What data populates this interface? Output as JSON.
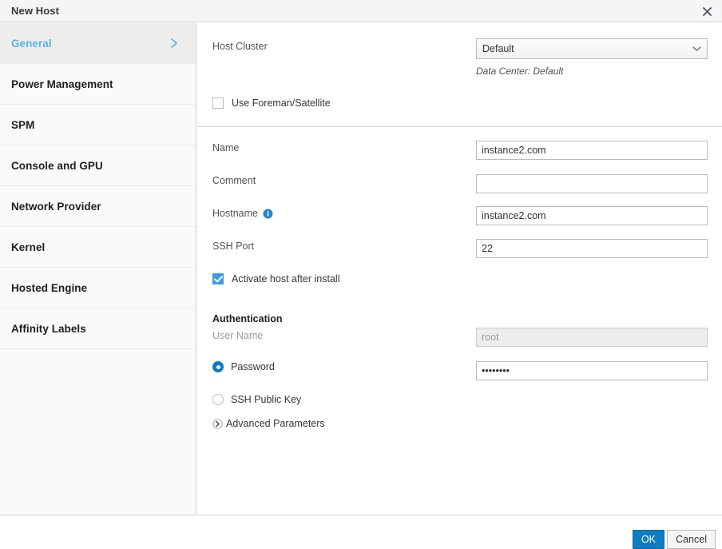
{
  "header": {
    "title": "New Host",
    "close_icon": "close-icon"
  },
  "sidebar": {
    "items": [
      {
        "label": "General",
        "active": true,
        "chevron_icon": "chevron-right-icon"
      },
      {
        "label": "Power Management",
        "active": false
      },
      {
        "label": "SPM",
        "active": false
      },
      {
        "label": "Console and GPU",
        "active": false
      },
      {
        "label": "Network Provider",
        "active": false
      },
      {
        "label": "Kernel",
        "active": false
      },
      {
        "label": "Hosted Engine",
        "active": false
      },
      {
        "label": "Affinity Labels",
        "active": false
      }
    ]
  },
  "form": {
    "host_cluster": {
      "label": "Host Cluster",
      "value": "Default",
      "hint": "Data Center: Default",
      "chevron_icon": "chevron-down-icon"
    },
    "use_foreman": {
      "label": "Use Foreman/Satellite",
      "checked": false
    },
    "name": {
      "label": "Name",
      "value": "instance2.com",
      "placeholder": ""
    },
    "comment": {
      "label": "Comment",
      "value": "",
      "placeholder": ""
    },
    "hostname": {
      "label": "Hostname",
      "value": "instance2.com",
      "placeholder": "",
      "info_icon": "info-icon"
    },
    "ssh_port": {
      "label": "SSH Port",
      "value": "22",
      "placeholder": ""
    },
    "activate_host": {
      "label": "Activate host after install",
      "checked": true
    },
    "authentication": {
      "title": "Authentication",
      "user_name": {
        "label": "User Name",
        "value": "",
        "placeholder": "root",
        "disabled": true
      },
      "password": {
        "label": "Password",
        "value": "••••••••",
        "selected": true
      },
      "ssh_public_key": {
        "label": "SSH Public Key",
        "selected": false
      },
      "advanced_parameters": {
        "label": "Advanced Parameters",
        "expander_icon": "chevron-right-circle-icon"
      }
    }
  },
  "footer": {
    "ok_label": "OK",
    "cancel_label": "Cancel"
  },
  "colors": {
    "accent": "#0f7dc2",
    "active_nav_text": "#5bb3e4",
    "checkbox_checked": "#3f9cdd",
    "radio_checked": "#0d7bc4"
  }
}
